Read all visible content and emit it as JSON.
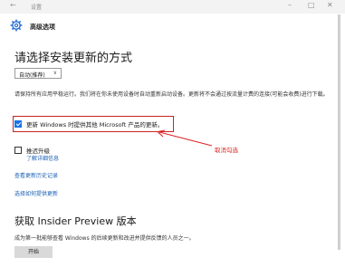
{
  "window": {
    "title": "设置",
    "back_glyph": "←",
    "minimize_glyph": "–",
    "maximize_glyph": "□",
    "close_glyph": "✕"
  },
  "header": {
    "title": "高级选项",
    "icon": "gear-icon"
  },
  "main": {
    "heading": "请选择安装更新的方式",
    "install_mode_select": {
      "value": "自动(推荐)",
      "chevron": "∨"
    },
    "description": "请保持所有应用平稳运行。我们将在你未使用设备时自动重新启动设备。更新将不会通过按流量计费的连接(可能会收费)进行下载。",
    "options": [
      {
        "label": "更新 Windows 时提供其他 Microsoft 产品的更新。",
        "checked": true
      },
      {
        "label": "推迟升级",
        "checked": false
      }
    ],
    "learn_more_link": "了解详细信息",
    "annotation": "取消勾选",
    "links": [
      "查看更新历史记录",
      "选择如何提供更新"
    ],
    "insider": {
      "heading": "获取 Insider Preview 版本",
      "description": "成为第一批能够查看 Windows 的后续更新和改进并提供反馈的人员之一。",
      "button": "开始"
    }
  },
  "colors": {
    "accent": "#1a73e8",
    "link": "#1a5fb4",
    "annotation": "#dd2222"
  }
}
